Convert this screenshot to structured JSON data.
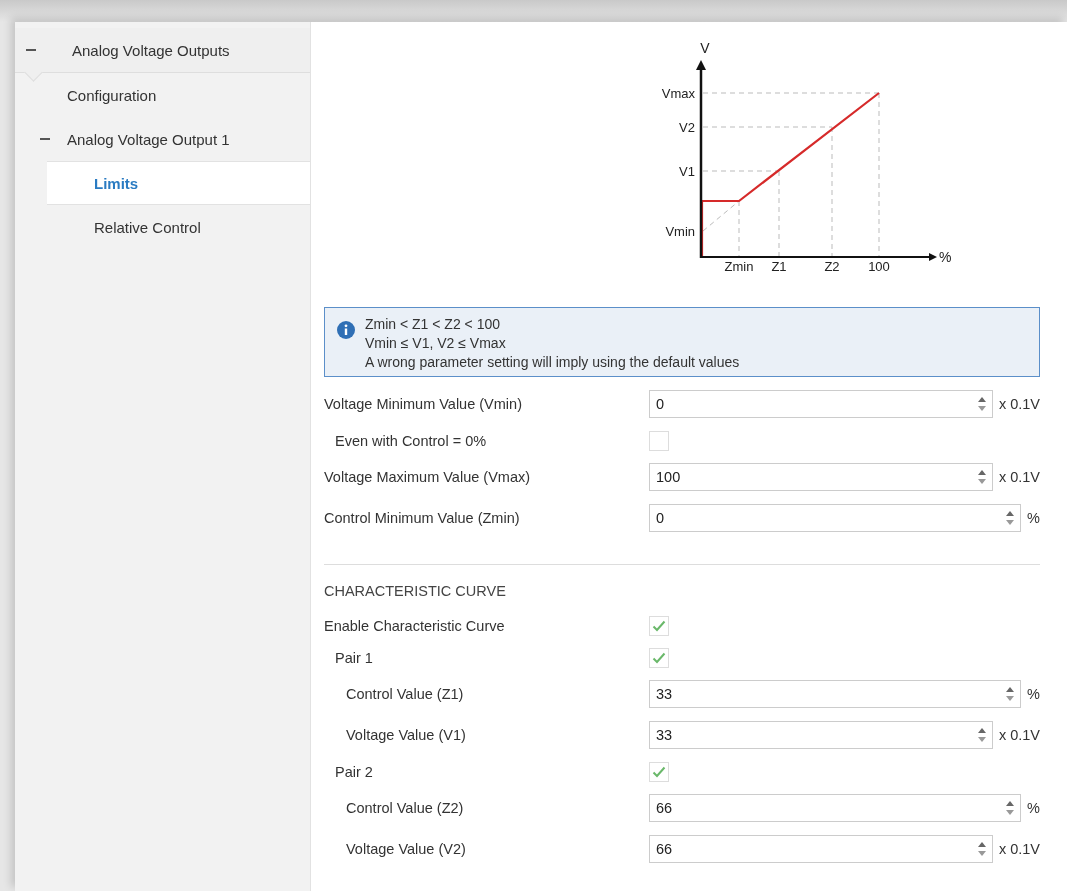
{
  "sidebar": {
    "items": [
      {
        "label": "Analog Voltage Outputs",
        "expanded": true,
        "children": [
          {
            "label": "Configuration",
            "selected": false
          },
          {
            "label": "Analog Voltage Output 1",
            "expanded": true,
            "selected": false,
            "children": [
              {
                "label": "Limits",
                "selected": true
              },
              {
                "label": "Relative Control",
                "selected": false
              }
            ]
          }
        ]
      }
    ]
  },
  "diagram": {
    "y_axis": "V",
    "x_axis": "%",
    "y_labels": [
      "Vmax",
      "V2",
      "V1",
      "Vmin"
    ],
    "x_labels": [
      "Zmin",
      "Z1",
      "Z2",
      "100"
    ]
  },
  "info": {
    "lines": [
      "Zmin < Z1 < Z2 < 100",
      "Vmin ≤ V1, V2 ≤ Vmax",
      "A wrong parameter setting will imply using the default values"
    ]
  },
  "form": [
    {
      "kind": "number",
      "label": "Voltage Minimum Value (Vmin)",
      "value": "0",
      "unit": "x 0.1V",
      "children": [
        {
          "kind": "checkbox",
          "label": "Even with Control = 0%",
          "checked": false
        }
      ]
    },
    {
      "kind": "number",
      "label": "Voltage Maximum Value (Vmax)",
      "value": "100",
      "unit": "x 0.1V"
    },
    {
      "kind": "number",
      "label": "Control Minimum Value (Zmin)",
      "value": "0",
      "unit": "%"
    },
    {
      "kind": "heading",
      "label": "CHARACTERISTIC CURVE"
    },
    {
      "kind": "checkbox",
      "label": "Enable Characteristic Curve",
      "checked": true,
      "children": [
        {
          "kind": "checkbox",
          "label": "Pair 1",
          "checked": true,
          "children": [
            {
              "kind": "number",
              "label": "Control Value (Z1)",
              "value": "33",
              "unit": "%"
            },
            {
              "kind": "number",
              "label": "Voltage Value (V1)",
              "value": "33",
              "unit": "x 0.1V"
            }
          ]
        },
        {
          "kind": "checkbox",
          "label": "Pair 2",
          "checked": true,
          "children": [
            {
              "kind": "number",
              "label": "Control Value (Z2)",
              "value": "66",
              "unit": "%"
            },
            {
              "kind": "number",
              "label": "Voltage Value (V2)",
              "value": "66",
              "unit": "x 0.1V"
            }
          ]
        }
      ]
    }
  ]
}
